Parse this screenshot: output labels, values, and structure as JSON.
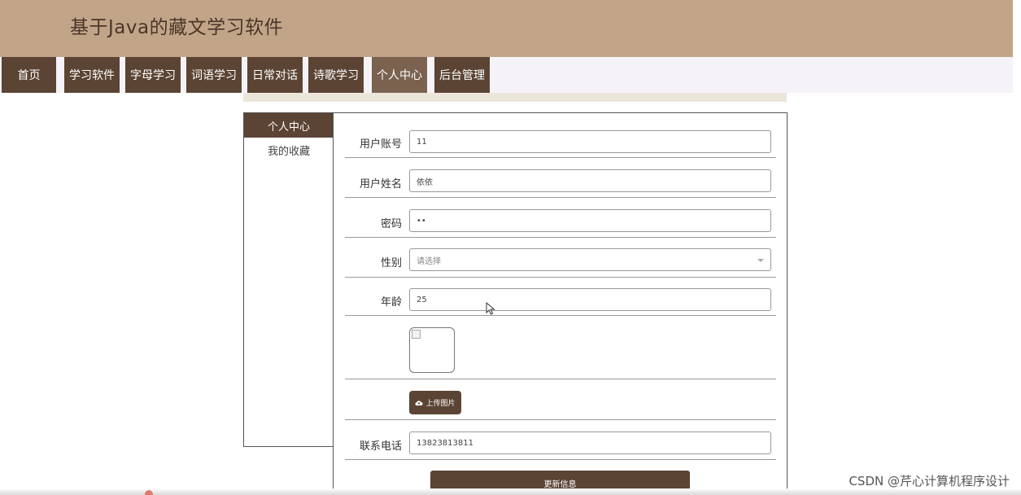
{
  "site": {
    "title": "基于Java的藏文学习软件"
  },
  "nav": {
    "items": [
      {
        "label": "首页"
      },
      {
        "label": "学习软件"
      },
      {
        "label": "字母学习"
      },
      {
        "label": "词语学习"
      },
      {
        "label": "日常对话"
      },
      {
        "label": "诗歌学习"
      },
      {
        "label": "个人中心",
        "active": true
      },
      {
        "label": "后台管理"
      }
    ]
  },
  "sidebar": {
    "items": [
      {
        "label": "个人中心",
        "active": true
      },
      {
        "label": "我的收藏"
      }
    ]
  },
  "form": {
    "account": {
      "label": "用户账号",
      "value": "11"
    },
    "name": {
      "label": "用户姓名",
      "value": "依依"
    },
    "password": {
      "label": "密码",
      "value": "••"
    },
    "gender": {
      "label": "性别",
      "value": "请选择"
    },
    "age": {
      "label": "年龄",
      "value": "25"
    },
    "upload_label": "上传图片",
    "phone": {
      "label": "联系电话",
      "value": "13823813811"
    },
    "submit_label": "更新信息"
  },
  "watermark": "CSDN @芹心计算机程序设计",
  "colors": {
    "header_bg": "#c2a589",
    "nav_bg": "#5b4434",
    "nav_active_bg": "#7a624f",
    "accent": "#5b4434"
  },
  "icons": {
    "upload": "cloud-upload-icon",
    "cursor": "mouse-pointer-icon",
    "select": "chevron-down-icon"
  }
}
